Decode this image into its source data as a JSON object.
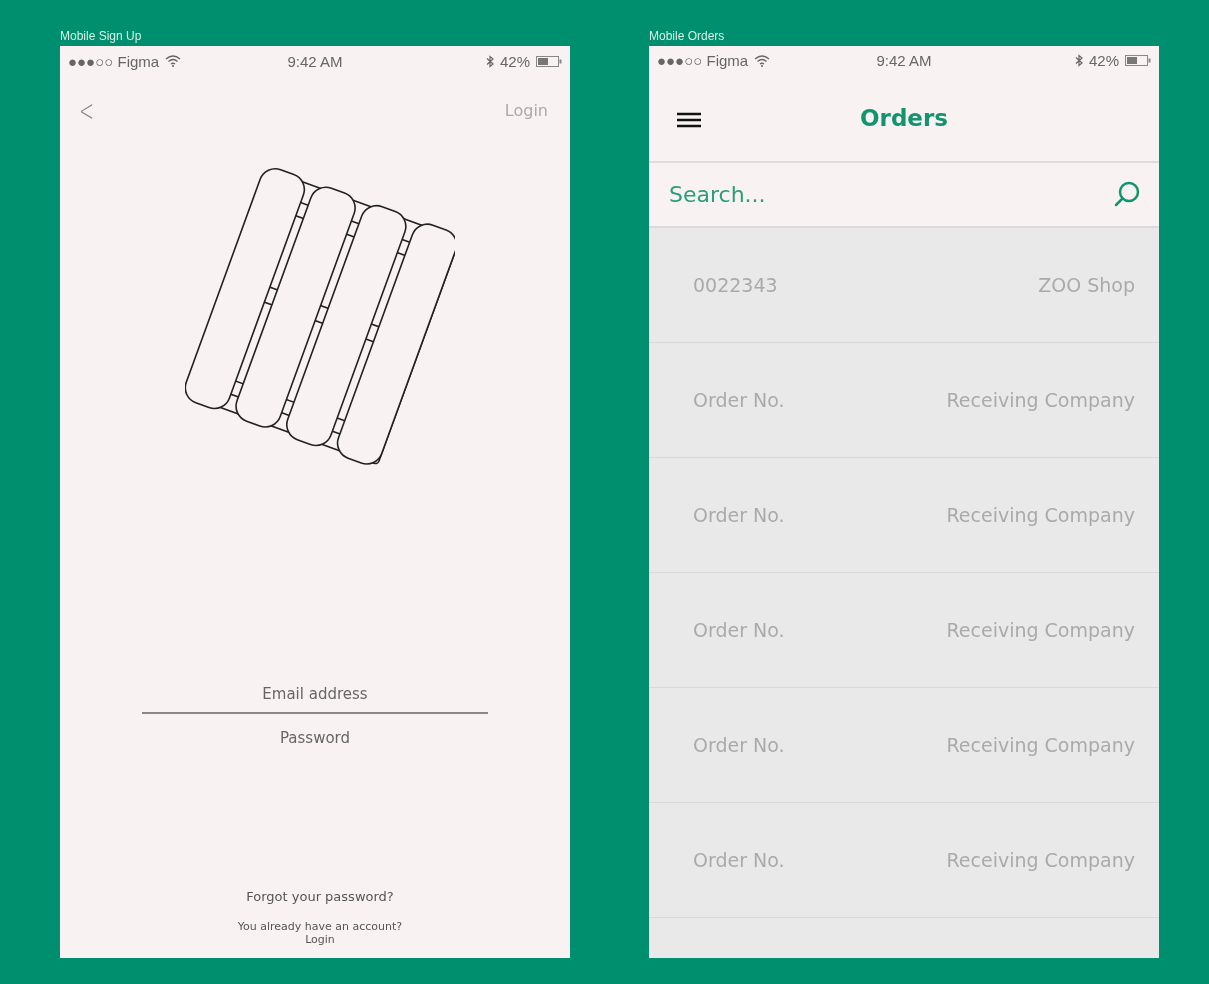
{
  "screens": [
    {
      "kind": "signup",
      "frame_label": "Mobile Sign Up",
      "status_bar": {
        "carrier": "●●●○○ Figma",
        "time": "9:42 AM",
        "battery": "42%"
      },
      "nav": {
        "back": "<",
        "action": "Login"
      },
      "fields": [
        {
          "placeholder": "Email address",
          "underlined": true
        },
        {
          "placeholder": "Password",
          "underlined": false
        }
      ],
      "forgot_link": "Forgot your password?",
      "account_text": "You already have an account?",
      "login_link": "Login"
    },
    {
      "kind": "orders",
      "frame_label": "Mobile Orders",
      "status_bar": {
        "carrier": "●●●○○ Figma",
        "time": "9:42 AM",
        "battery": "42%"
      },
      "title": "Orders",
      "search": {
        "placeholder": "Search..."
      },
      "rows": [
        {
          "order": "0022343",
          "company": "ZOO Shop"
        },
        {
          "order": "Order No.",
          "company": "Receiving Company"
        },
        {
          "order": "Order No.",
          "company": "Receiving Company"
        },
        {
          "order": "Order No.",
          "company": "Receiving Company"
        },
        {
          "order": "Order No.",
          "company": "Receiving Company"
        },
        {
          "order": "Order No.",
          "company": "Receiving Company"
        }
      ]
    }
  ]
}
